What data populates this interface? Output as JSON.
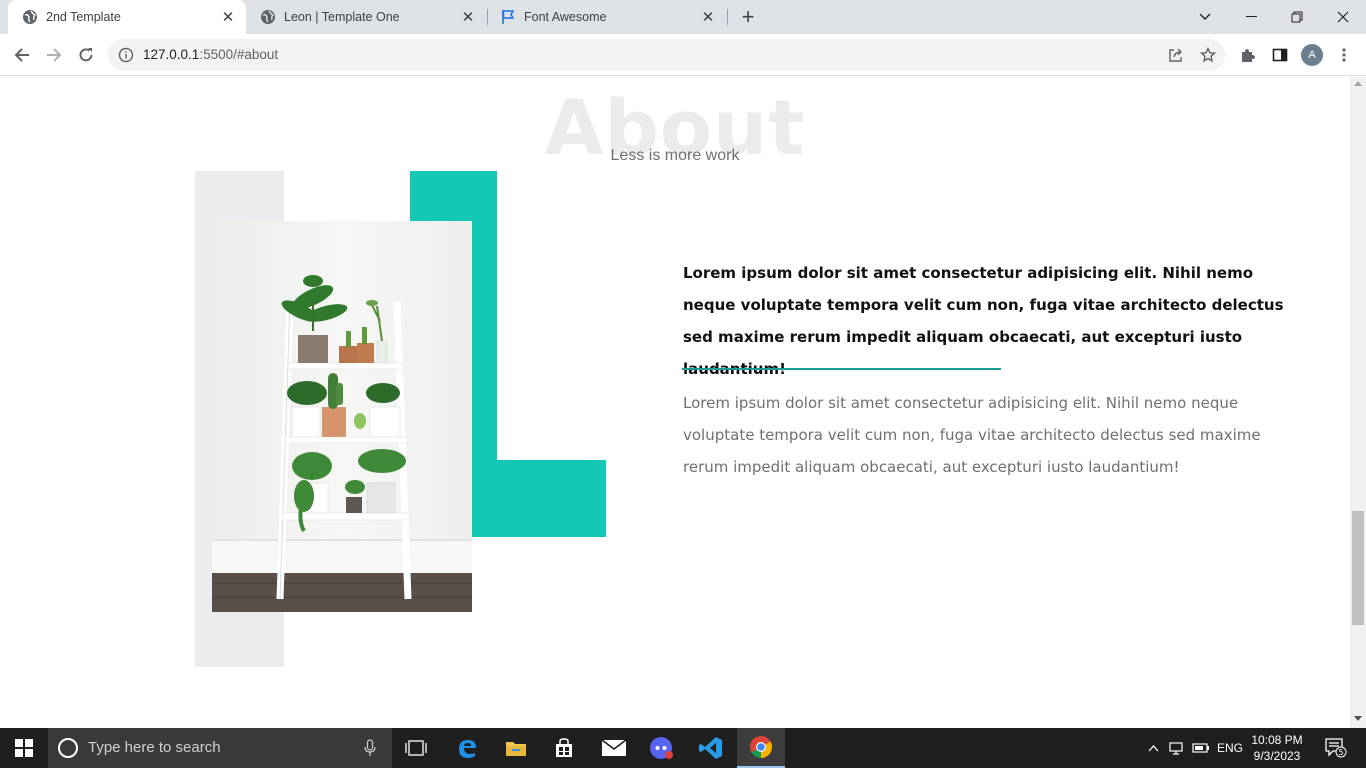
{
  "browser": {
    "tabs": [
      {
        "title": "2nd Template",
        "active": true,
        "icon": "globe-icon"
      },
      {
        "title": "Leon | Template One",
        "active": false,
        "icon": "globe-icon"
      },
      {
        "title": "Font Awesome",
        "active": false,
        "icon": "flag-icon"
      }
    ],
    "url_host": "127.0.0.1",
    "url_rest": ":5500/#about",
    "avatar_letter": "A"
  },
  "page": {
    "section_heading": "About",
    "section_subtitle": "Less is more work",
    "bold_paragraph": "Lorem ipsum dolor sit amet consectetur adipisicing elit. Nihil nemo neque voluptate tempora velit cum non, fuga vitae architecto delectus sed maxime rerum impedit aliquam obcaecati, aut excepturi iusto laudantium!",
    "regular_paragraph": "Lorem ipsum dolor sit amet consectetur adipisicing elit. Nihil nemo neque voluptate tempora velit cum non, fuga vitae architecto delectus sed maxime rerum impedit aliquam obcaecati, aut excepturi iusto laudantium!",
    "colors": {
      "accent": "#13c8b5",
      "divider": "#1a9e96",
      "block": "#ebeced"
    }
  },
  "taskbar": {
    "search_placeholder": "Type here to search",
    "language": "ENG",
    "time": "10:08 PM",
    "date": "9/3/2023",
    "notification_count": "5"
  }
}
